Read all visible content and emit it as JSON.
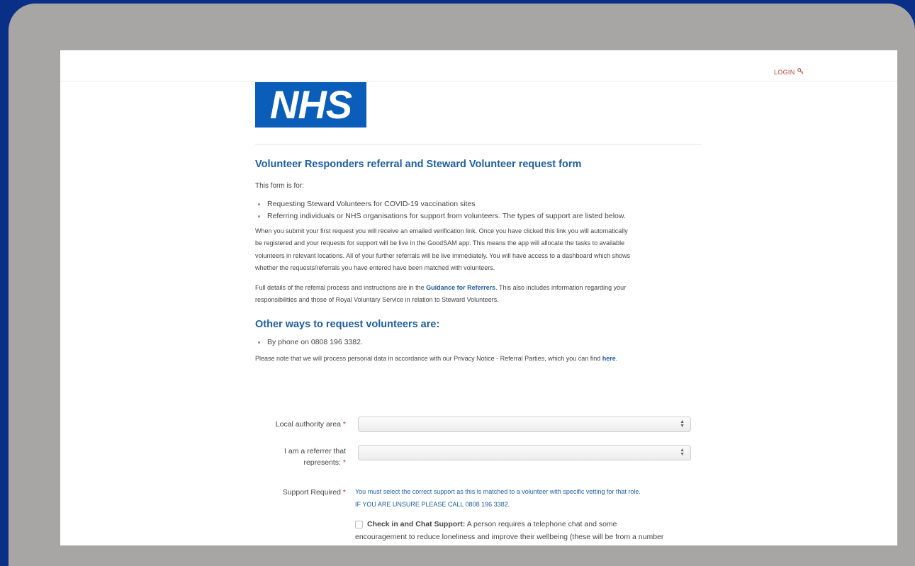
{
  "header": {
    "login_label": "LOGIN"
  },
  "logo": {
    "text": "NHS"
  },
  "form_title": "Volunteer Responders referral and Steward Volunteer request form",
  "intro": "This form is for:",
  "purposes": [
    "Requesting Steward Volunteers for COVID-19 vaccination sites",
    "Referring individuals or NHS organisations for support from volunteers. The types of support are listed below."
  ],
  "description_lines": [
    "When you submit your first request you will receive an emailed verification link. Once you have clicked this link you will automatically",
    "be registered and your requests for support will be live in the GoodSAM app. This means the app will allocate the tasks to available",
    "volunteers in relevant locations. All of your further referrals will be live immediately. You will have access to a dashboard which shows",
    "whether the requests/referrals you have entered have been matched with volunteers."
  ],
  "guidance": {
    "before": "Full details of the referral process and instructions are in the ",
    "link": "Guidance for Referrers",
    "after": ". This also includes information regarding your",
    "line2": "responsibilities and those of Royal Voluntary Service in relation to Steward Volunteers."
  },
  "other_ways": {
    "heading": "Other ways to request volunteers are:",
    "items": [
      "By phone on 0808 196 3382."
    ]
  },
  "privacy": {
    "before": "Please note that we will process personal data in accordance with our Privacy Notice - Referral Parties, which you can find ",
    "link": "here",
    "after": "."
  },
  "fields": {
    "local_authority": {
      "label": "Local authority area",
      "required_mark": "*",
      "value": ""
    },
    "referrer": {
      "label_line1": "I am a referrer that",
      "label_line2": "represents:",
      "required_mark": "*",
      "value": ""
    },
    "support": {
      "label": "Support Required",
      "required_mark": "*",
      "notice_line1": "You must select the correct support as this is matched to a volunteer with specific vetting for that role.",
      "notice_line2": "IF YOU ARE UNSURE PLEASE CALL 0808 196 3382.",
      "options": [
        {
          "title": "Check in and Chat Support:",
          "text_line1": " A person requires a telephone chat and some",
          "text_line2": "encouragement to reduce loneliness and improve their wellbeing (these will be from a number",
          "checked": false
        }
      ]
    }
  }
}
